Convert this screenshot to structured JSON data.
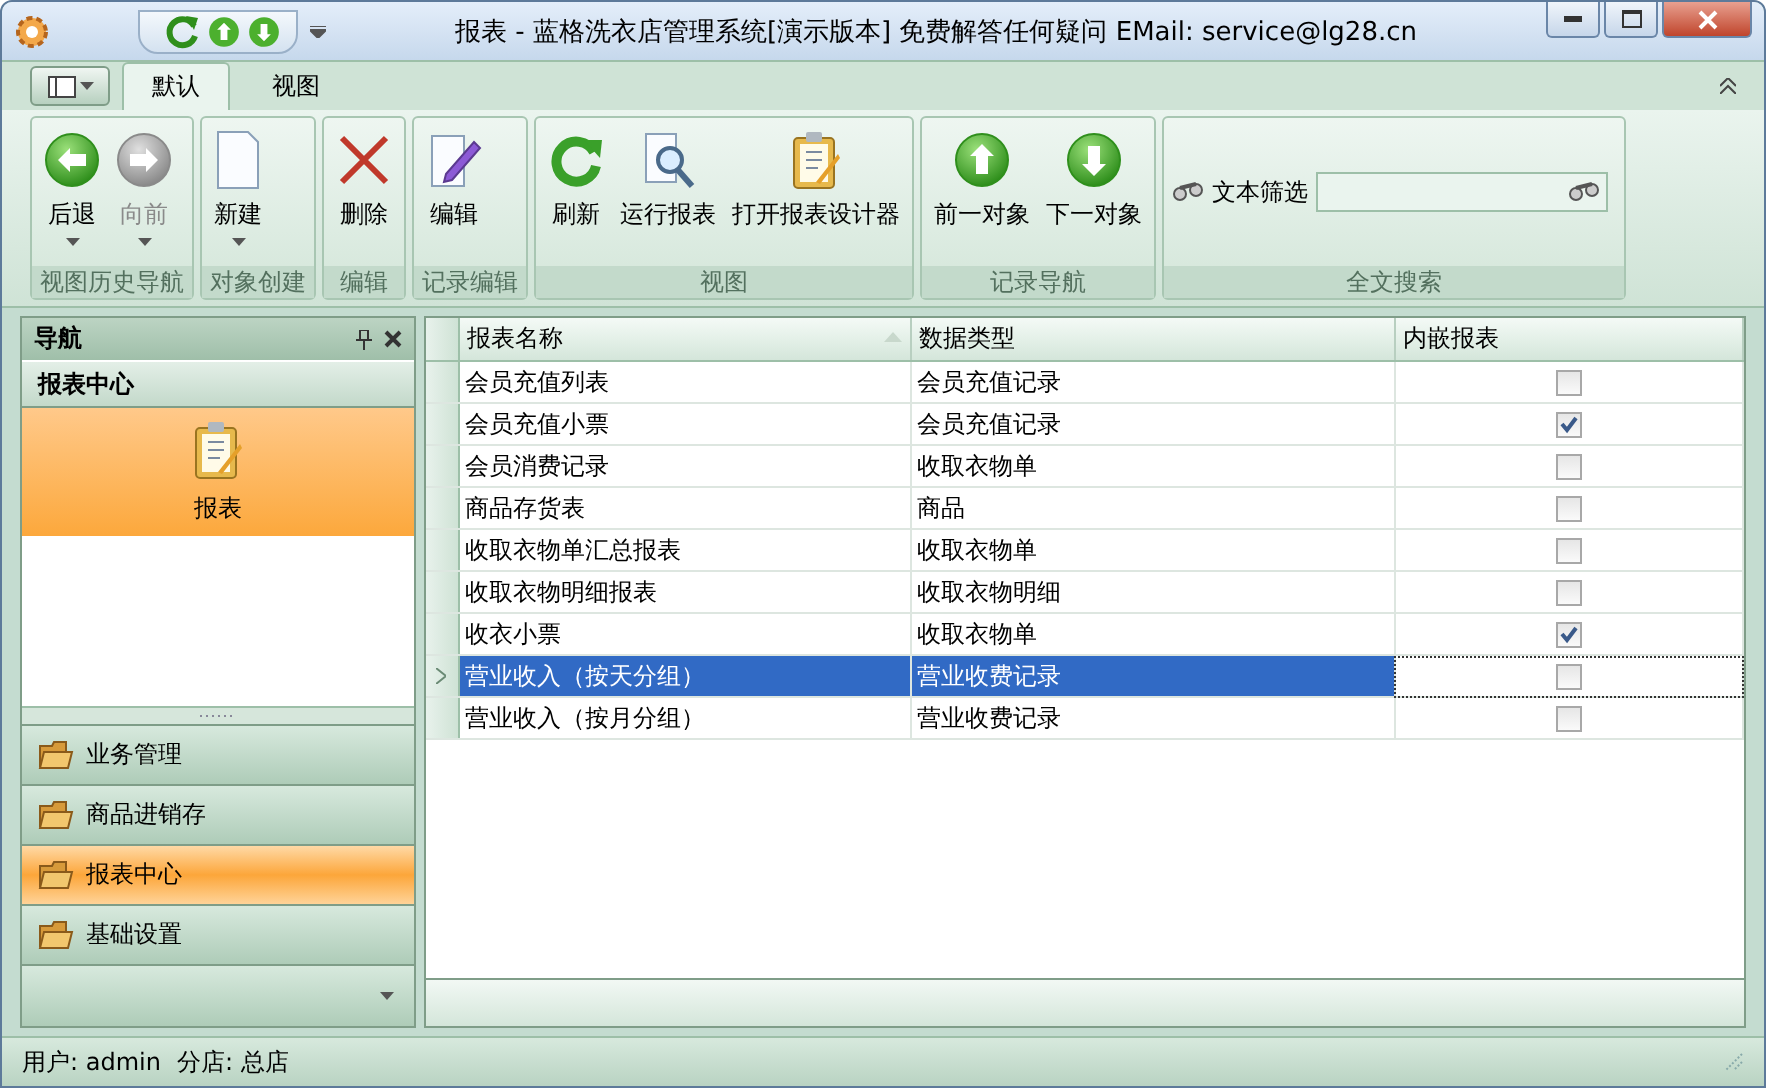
{
  "window": {
    "title": "报表 - 蓝格洗衣店管理系统[演示版本] 免费解答任何疑问 EMail: service@lg28.cn"
  },
  "ribbon": {
    "tabs": [
      {
        "label": "默认",
        "selected": true
      },
      {
        "label": "视图",
        "selected": false
      }
    ],
    "groups": [
      {
        "caption": "视图历史导航",
        "buttons": [
          {
            "label": "后退",
            "disabled": false,
            "dropdown": true
          },
          {
            "label": "向前",
            "disabled": true,
            "dropdown": true
          }
        ]
      },
      {
        "caption": "对象创建",
        "buttons": [
          {
            "label": "新建",
            "disabled": false,
            "dropdown": true
          }
        ]
      },
      {
        "caption": "编辑",
        "buttons": [
          {
            "label": "删除",
            "disabled": false,
            "dropdown": false
          }
        ]
      },
      {
        "caption": "记录编辑",
        "buttons": [
          {
            "label": "编辑",
            "disabled": false,
            "dropdown": false
          }
        ]
      },
      {
        "caption": "视图",
        "buttons": [
          {
            "label": "刷新",
            "disabled": false,
            "dropdown": false
          },
          {
            "label": "运行报表",
            "disabled": false,
            "dropdown": false
          },
          {
            "label": "打开报表设计器",
            "disabled": false,
            "dropdown": false
          }
        ]
      },
      {
        "caption": "记录导航",
        "buttons": [
          {
            "label": "前一对象",
            "disabled": false,
            "dropdown": false
          },
          {
            "label": "下一对象",
            "disabled": false,
            "dropdown": false
          }
        ]
      }
    ],
    "search": {
      "caption": "全文搜索",
      "label": "文本筛选"
    }
  },
  "navigation": {
    "title": "导航",
    "section": "报表中心",
    "items": [
      {
        "label": "报表",
        "selected": true
      }
    ],
    "groups": [
      {
        "label": "业务管理",
        "selected": false
      },
      {
        "label": "商品进销存",
        "selected": false
      },
      {
        "label": "报表中心",
        "selected": true
      },
      {
        "label": "基础设置",
        "selected": false
      }
    ]
  },
  "table": {
    "columns": [
      "报表名称",
      "数据类型",
      "内嵌报表"
    ],
    "rows": [
      {
        "name": "会员充值列表",
        "type": "会员充值记录",
        "embedded": false,
        "selected": false
      },
      {
        "name": "会员充值小票",
        "type": "会员充值记录",
        "embedded": true,
        "selected": false
      },
      {
        "name": "会员消费记录",
        "type": "收取衣物单",
        "embedded": false,
        "selected": false
      },
      {
        "name": "商品存货表",
        "type": "商品",
        "embedded": false,
        "selected": false
      },
      {
        "name": "收取衣物单汇总报表",
        "type": "收取衣物单",
        "embedded": false,
        "selected": false
      },
      {
        "name": "收取衣物明细报表",
        "type": "收取衣物明细",
        "embedded": false,
        "selected": false
      },
      {
        "name": "收衣小票",
        "type": "收取衣物单",
        "embedded": true,
        "selected": false
      },
      {
        "name": "营业收入（按天分组）",
        "type": "营业收费记录",
        "embedded": false,
        "selected": true
      },
      {
        "name": "营业收入（按月分组）",
        "type": "营业收费记录",
        "embedded": false,
        "selected": false
      }
    ]
  },
  "status_bar": {
    "user": "用户: admin",
    "branch": "分店: 总店"
  }
}
